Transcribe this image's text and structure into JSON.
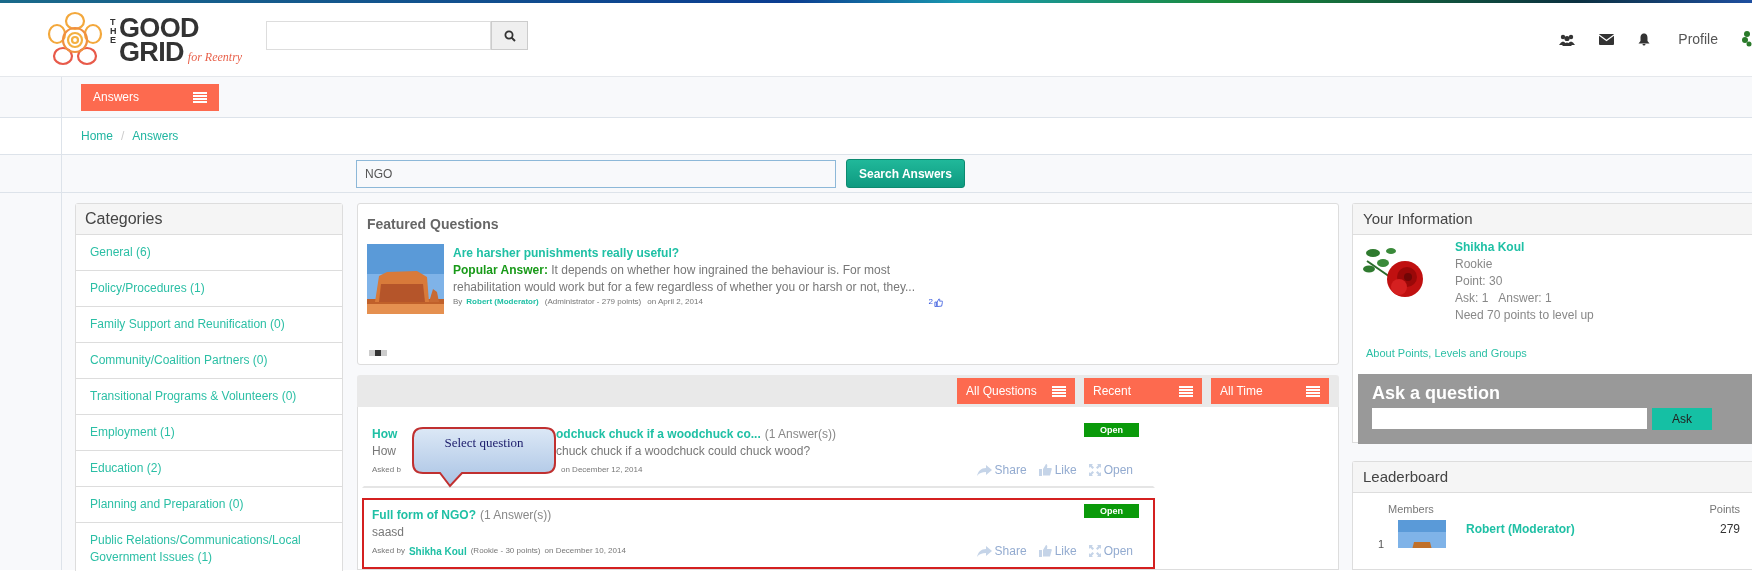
{
  "logo": {
    "the": "THE",
    "good": "GOOD",
    "grid": "GRID",
    "tagline": "for Reentry"
  },
  "header": {
    "profile": "Profile"
  },
  "menu": {
    "label": "Answers"
  },
  "breadcrumb": {
    "separator": "/",
    "items": [
      "Home",
      "Answers"
    ]
  },
  "answer_search": {
    "value": "NGO",
    "button": "Search Answers"
  },
  "categories": {
    "title": "Categories",
    "items": [
      {
        "label": "General (6)"
      },
      {
        "label": "Policy/Procedures (1)"
      },
      {
        "label": "Family Support and Reunification (0)"
      },
      {
        "label": "Community/Coalition Partners (0)"
      },
      {
        "label": "Transitional Programs & Volunteers (0)"
      },
      {
        "label": "Employment (1)"
      },
      {
        "label": "Education (2)"
      },
      {
        "label": "Planning and Preparation (0)"
      },
      {
        "label": "Public Relations/Communications/Local Government Issues (1)"
      }
    ]
  },
  "featured": {
    "title": "Featured Questions",
    "question": "Are harsher punishments really useful?",
    "answer_label": "Popular Answer:",
    "answer": "It depends on whether how ingrained the behaviour is. For most rehabilitation would work but for a few regardless of whether you or harsh or not, they...",
    "by": "By",
    "author": "Robert (Moderator)",
    "author_info": "(Administrator - 279 points)",
    "date": "on April 2, 2014",
    "likes": "2",
    "slides": [
      {
        "selected": false
      },
      {
        "selected": true
      },
      {
        "selected": false
      }
    ]
  },
  "filters": [
    {
      "label": "All Questions"
    },
    {
      "label": "Recent"
    },
    {
      "label": "All Time"
    }
  ],
  "questions": [
    {
      "kind": "covered",
      "title_parts": [
        "How",
        "odchuck chuck if a woodchuck co..."
      ],
      "answers": "(1 Answer(s))",
      "body_parts": [
        "How",
        "chuck chuck if a woodchuck could chuck wood?"
      ],
      "meta_parts": [
        "Asked b",
        "on December 12, 2014"
      ],
      "status": "Open",
      "highlighted": false,
      "actions": [
        "Share",
        "Like",
        "Open"
      ]
    },
    {
      "kind": "plain",
      "title": "Full form of NGO?",
      "answers": "(1 Answer(s))",
      "body": "saasd",
      "asked_by": "Asked by",
      "author": "Shikha Koul",
      "author_info": "(Rookie - 30 points)",
      "date": "on December 10, 2014",
      "status": "Open",
      "highlighted": true,
      "actions": [
        "Share",
        "Like",
        "Open"
      ]
    }
  ],
  "callout": {
    "text": "Select question"
  },
  "your_info": {
    "title": "Your Information",
    "name": "Shikha Koul",
    "lines": [
      "Rookie",
      "Point: 30"
    ],
    "ask": "Ask: 1",
    "answer": "Answer: 1",
    "need": "Need 70 points to level up",
    "link": "About Points, Levels and Groups"
  },
  "ask_box": {
    "title": "Ask a question",
    "button": "Ask"
  },
  "leaderboard": {
    "title": "Leaderboard",
    "col_members": "Members",
    "col_points": "Points",
    "rows": [
      {
        "rank": "1",
        "name": "Robert (Moderator)",
        "points": "279"
      }
    ]
  }
}
